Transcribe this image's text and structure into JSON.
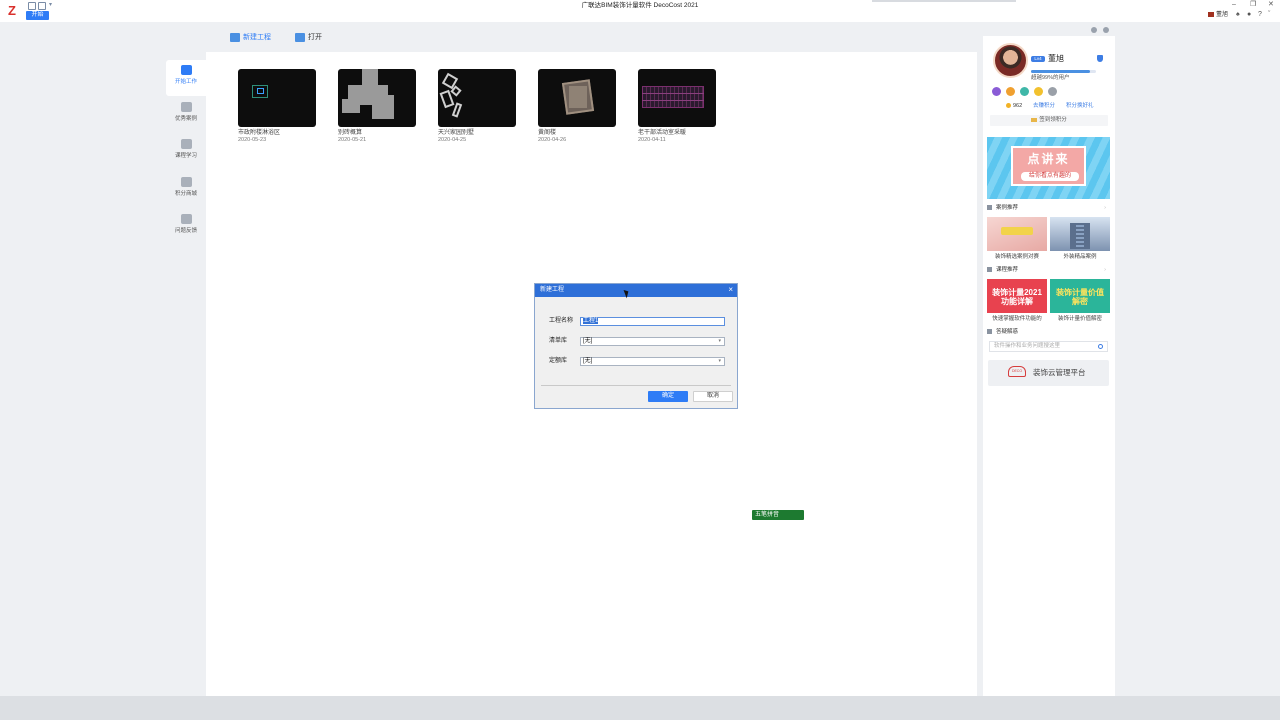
{
  "titlebar": {
    "window_title": "广联达BIM装饰计量软件 DecoCost 2021",
    "start_tab": "开始",
    "username": "董旭"
  },
  "left_nav": {
    "items": [
      {
        "label": "开始工作",
        "icon": "monitor-icon",
        "active": true
      },
      {
        "label": "优秀案例",
        "icon": "crown-icon",
        "active": false
      },
      {
        "label": "课程学习",
        "icon": "book-icon",
        "active": false
      },
      {
        "label": "积分商城",
        "icon": "bag-icon",
        "active": false
      },
      {
        "label": "问题反馈",
        "icon": "feedback-icon",
        "active": false
      }
    ]
  },
  "toolbar": {
    "new_project": "新建工程",
    "open": "打开"
  },
  "projects": [
    {
      "name": "市政附楼淋浴区",
      "date": "2020-05-23"
    },
    {
      "name": "别砖概算",
      "date": "2020-05-21"
    },
    {
      "name": "天兴家园别墅",
      "date": "2020-04-25"
    },
    {
      "name": "黄阁楼",
      "date": "2020-04-26"
    },
    {
      "name": "老干部活动室采暖",
      "date": "2020-04-11"
    }
  ],
  "dialog": {
    "title": "新建工程",
    "name_label": "工程名称",
    "name_value": "工程1",
    "list_label": "清单库",
    "list_value": "[无]",
    "quota_label": "定额库",
    "quota_value": "[无]",
    "ok": "确定",
    "cancel": "取消"
  },
  "ime": {
    "label": "五笔拼音"
  },
  "right_panel": {
    "username": "董旭",
    "level_badge": "Lv4",
    "rank_text": "超越99%的用户",
    "progress": 0.9,
    "points": "962",
    "points_link": "去赚积分",
    "points_link2": "积分换好礼",
    "daily_points": "签到领积分",
    "ad_title": "点讲来",
    "ad_subtitle": "给你看点有趣的",
    "case_header": "案例推荐",
    "cases": [
      {
        "caption": "装饰精选案例对赛"
      },
      {
        "caption": "外装精品案例"
      }
    ],
    "course_header": "课程推荐",
    "courses": [
      {
        "thumb_text": "装饰计量2021功能详解",
        "caption": "快速掌握软件功能的"
      },
      {
        "thumb_text": "装饰计量价值解密",
        "caption": "装饰计量价值解密"
      }
    ],
    "qa_header": "答疑解惑",
    "qa_placeholder": "软件操作和业务问题搜这里",
    "cloud_logo_text": "DECO",
    "cloud_text": "装饰云管理平台"
  },
  "colors": {
    "accent": "#2e7cf6",
    "dialog_title_bg": "#2e6fd8",
    "ime_green": "#1d7a30"
  }
}
